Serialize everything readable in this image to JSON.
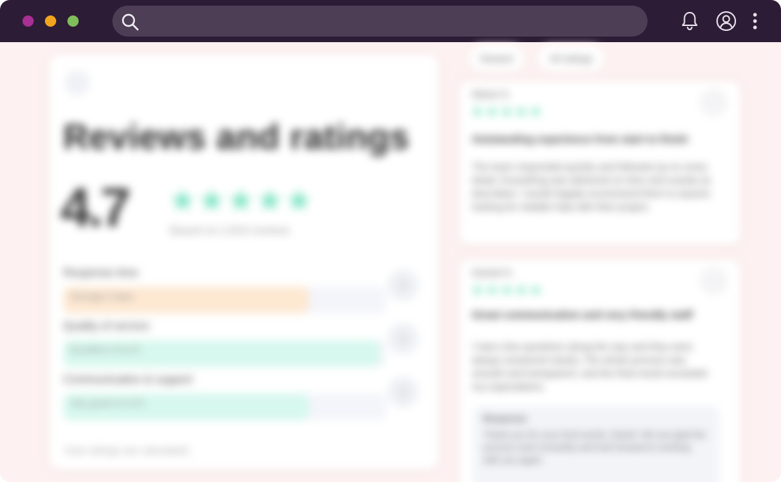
{
  "window": {
    "traffic_lights": {
      "close_color": "#a82f93",
      "minimize_color": "#f1a51e",
      "maximize_color": "#7fbe5a"
    },
    "titlebar_color": "#2d1c35"
  },
  "search": {
    "placeholder": "",
    "value": ""
  },
  "toolbar": {
    "icons": [
      "bell-icon",
      "account-icon",
      "more-vertical-icon"
    ]
  },
  "overview": {
    "title": "Reviews and ratings",
    "score": "4.7",
    "stars": "★★★★★",
    "review_count": "Based on 2,816 reviews",
    "metrics": [
      {
        "label": "Response time",
        "value_label": "Average 2 days",
        "fill": 0.76,
        "color": "#fde8d2"
      },
      {
        "label": "Quality of service",
        "value_label": "Excellent 4.8 of 5",
        "fill": 0.98,
        "color": "#d7f8ee"
      },
      {
        "label": "Communication & support",
        "value_label": "Very good 4.5 of 5",
        "fill": 0.76,
        "color": "#d7f8ee"
      }
    ],
    "footnote": "How ratings are calculated"
  },
  "filters": [
    {
      "label": "Newest"
    },
    {
      "label": "All ratings"
    }
  ],
  "reviews": [
    {
      "reviewer": "Maria S.",
      "stars": "★★★★★",
      "title": "Outstanding experience from start to finish",
      "body": "The team responded quickly and followed up on every detail. Everything was delivered on time and exactly as described. I would happily recommend them to anyone looking for reliable help with their project."
    },
    {
      "reviewer": "Daniel K.",
      "stars": "★★★★★",
      "title": "Great communication and very friendly staff",
      "body": "I had a few questions along the way and they were always answered clearly. The whole process was smooth and transparent, and the final result exceeded my expectations.",
      "reply_label": "Response",
      "reply_text": "Thank you for your kind words, Daniel. We are glad the process went smoothly and look forward to working with you again."
    }
  ]
}
